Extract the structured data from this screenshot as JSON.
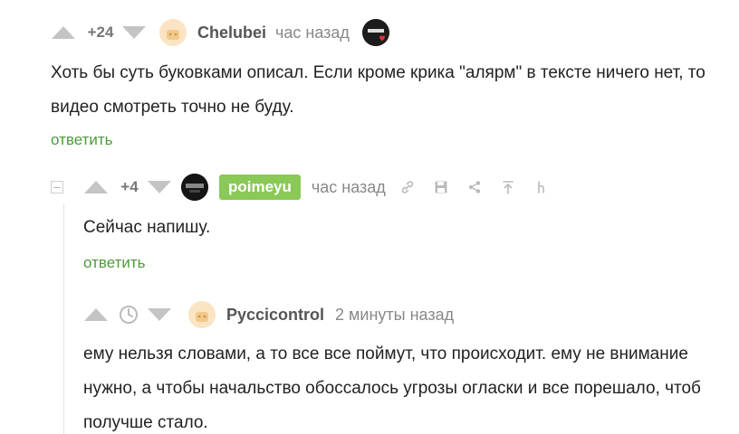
{
  "comments": [
    {
      "score": "+24",
      "username": "Chelubei",
      "time": "час назад",
      "text": "Хоть бы суть буковками описал. Если кроме крика \"алярм\" в тексте ничего нет, то видео смотреть точно не буду.",
      "reply": "ответить"
    },
    {
      "score": "+4",
      "username": "poimeyu",
      "time": "час назад",
      "text": "Сейчас напишу.",
      "reply": "ответить"
    },
    {
      "username": "Pyccicontrol",
      "time": "2 минуты назад",
      "text": "ему нельзя словами, а то все все поймут, что происходит. ему не внимание нужно, а чтобы начальство обоссалось угрозы огласки и все порешало, чтоб получше стало."
    }
  ],
  "colors": {
    "reply": "#4f9a3a",
    "badge": "#8ac858",
    "vote": "#c4c4c4"
  }
}
